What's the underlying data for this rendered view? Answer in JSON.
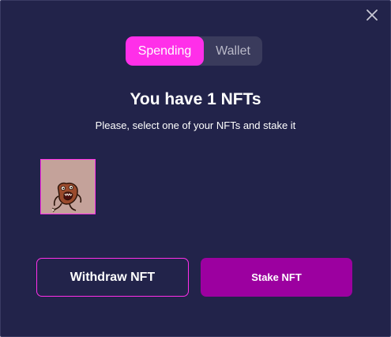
{
  "modal": {
    "close_icon": "close-icon"
  },
  "toggle": {
    "options": [
      {
        "label": "Spending",
        "active": true
      },
      {
        "label": "Wallet",
        "active": false
      }
    ]
  },
  "heading": {
    "title": "You have 1 NFTs",
    "subtitle": "Please, select one of your NFTs and stake it"
  },
  "nfts": [
    {
      "image": "nft-monster-image",
      "selected": true
    }
  ],
  "actions": {
    "withdraw_label": "Withdraw NFT",
    "stake_label": "Stake NFT"
  },
  "colors": {
    "background": "#22234a",
    "accent": "#ff2fe9",
    "stake_button": "#9c00a0",
    "toggle_bg": "#3a3b5c"
  }
}
